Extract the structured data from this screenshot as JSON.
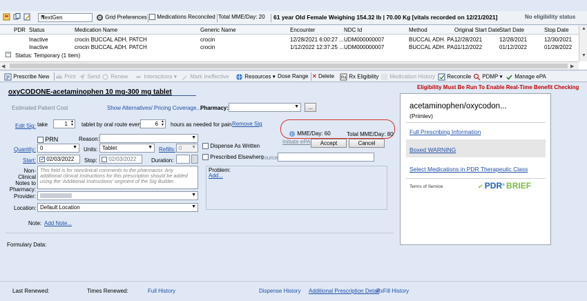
{
  "topbar": {
    "provider_select": "NextGen",
    "grid_preferences": "Grid Preferences",
    "meds_reconciled": "Medications Reconciled",
    "total_mme": "Total MME/Day:  20",
    "patient_info": "61 year Old Female Weighing 154.32 lb  |  70.00 Kg [vitals recorded on 12/21/2021]",
    "eligibility_status": "No eligibility status"
  },
  "grid": {
    "columns": [
      "PDR",
      "Status",
      "Medication Name",
      "Generic Name",
      "Encounter",
      "NDC Id",
      "Method",
      "Original Start Date",
      "Start Date",
      "Stop Date"
    ],
    "rows": [
      [
        "",
        "Inactive",
        "crocin  BUCCAL ADH. PATCH",
        "crocin",
        "12/28/2021 6:00:27 ...",
        "UDM000000007",
        "BUCCAL ADH. PA...",
        "12/28/2021",
        "12/28/2021",
        "12/30/2021"
      ],
      [
        "",
        "Inactive",
        "crocin  BUCCAL ADH. PATCH",
        "crocin",
        "1/12/2022 12:37:25 ...",
        "UDM000000007",
        "BUCCAL ADH. PA...",
        "01/12/2022",
        "01/12/2022",
        "01/28/2022"
      ]
    ],
    "group_label": "Status:  Temporary (1 item)"
  },
  "actions": {
    "prescribe_new": "Prescribe New",
    "print": "Print",
    "send": "Send",
    "renew": "Renew",
    "interactions": "Interactions",
    "mark_ineffective": "Mark Ineffective",
    "resources": "Resources",
    "dose_range": "Dose Range",
    "delete": "Delete",
    "rx_eligibility": "Rx Eligibility",
    "medication_history": "Medication History",
    "reconcile": "Reconcile",
    "pdmp": "PDMP",
    "manage_epa": "Manage ePA"
  },
  "drug_title": "oxyCODONE-acetaminophen 10 mg-300 mg tablet",
  "eligibility_warning": "Eligibility Must Be Run To Enable Real-Time Benefit Checking",
  "form": {
    "estimated_cost": "Estimated Patient Cost",
    "show_alternatives": "Show Alternatives/ Pricing Coverage...",
    "pharmacy_label": "Pharmacy:",
    "pharmacy_value": "",
    "pharmacy_btn": "...",
    "edit_sig": "Edit Sig:",
    "take": "take",
    "take_qty": "1",
    "route_text": "tablet by oral route every",
    "every_qty": "6",
    "hours_text": "hours as needed for pain",
    "remove_sig": "Remove Sig",
    "prn": "PRN",
    "reason_label": "Reason:",
    "reason_value": "",
    "quantity_label": "Quantity:",
    "quantity_value": "0",
    "units_label": "Units:",
    "units_value": "Tablet",
    "refills_label": "Refills:",
    "refills_value": "0",
    "start_label": "Start:",
    "start_value": "02/03/2022",
    "stop_label": "Stop:",
    "stop_value": "02/03/2022",
    "duration_label": "Duration:",
    "duration_value": "",
    "dispense_as_written": "Dispense As Written",
    "prescribed_elsewhere": "Prescribed Elsewhere",
    "source_label": "Source:",
    "mme_day": "MME/Day: 60",
    "total_mme_day": "Total MME/Day: 80",
    "initiate_epa": "Initiate ePA",
    "accept": "Accept",
    "cancel": "Cancel",
    "notes_label": "Non-Clinical Notes to Pharmacy:",
    "notes_placeholder": "This field is for nonclinical comments to the pharmacist. Any additional clinical instructions for this prescription should be added using the 'Additional Instructions' segment of the Sig Builder.",
    "problem_label": "Problem:",
    "problem_add": "Add...",
    "provider_label": "Provider:",
    "provider_value": "",
    "location_label": "Location:",
    "location_value": "Default Location",
    "note_label": "Note:",
    "add_note": "Add Note...",
    "formulary_label": "Formulary Data:"
  },
  "pdr_panel": {
    "drug": "acetaminophen/oxycodon...",
    "brand": "(Primlev)",
    "full_info": "Full Prescribing Information",
    "boxed_warning": "Boxed WARNING",
    "select_meds": "Select Medications in PDR Therapeutic Class",
    "terms": "Terms of Service",
    "logo_pdr": "PDR",
    "logo_brief": "BRIEF"
  },
  "footer": {
    "last_renewed": "Last Renewed:",
    "times_renewed": "Times Renewed:",
    "full_history": "Full History",
    "dispense_history": "Dispense History",
    "additional_detail": "Additional Prescription Detail",
    "rxfill_history": "RxFill History"
  }
}
